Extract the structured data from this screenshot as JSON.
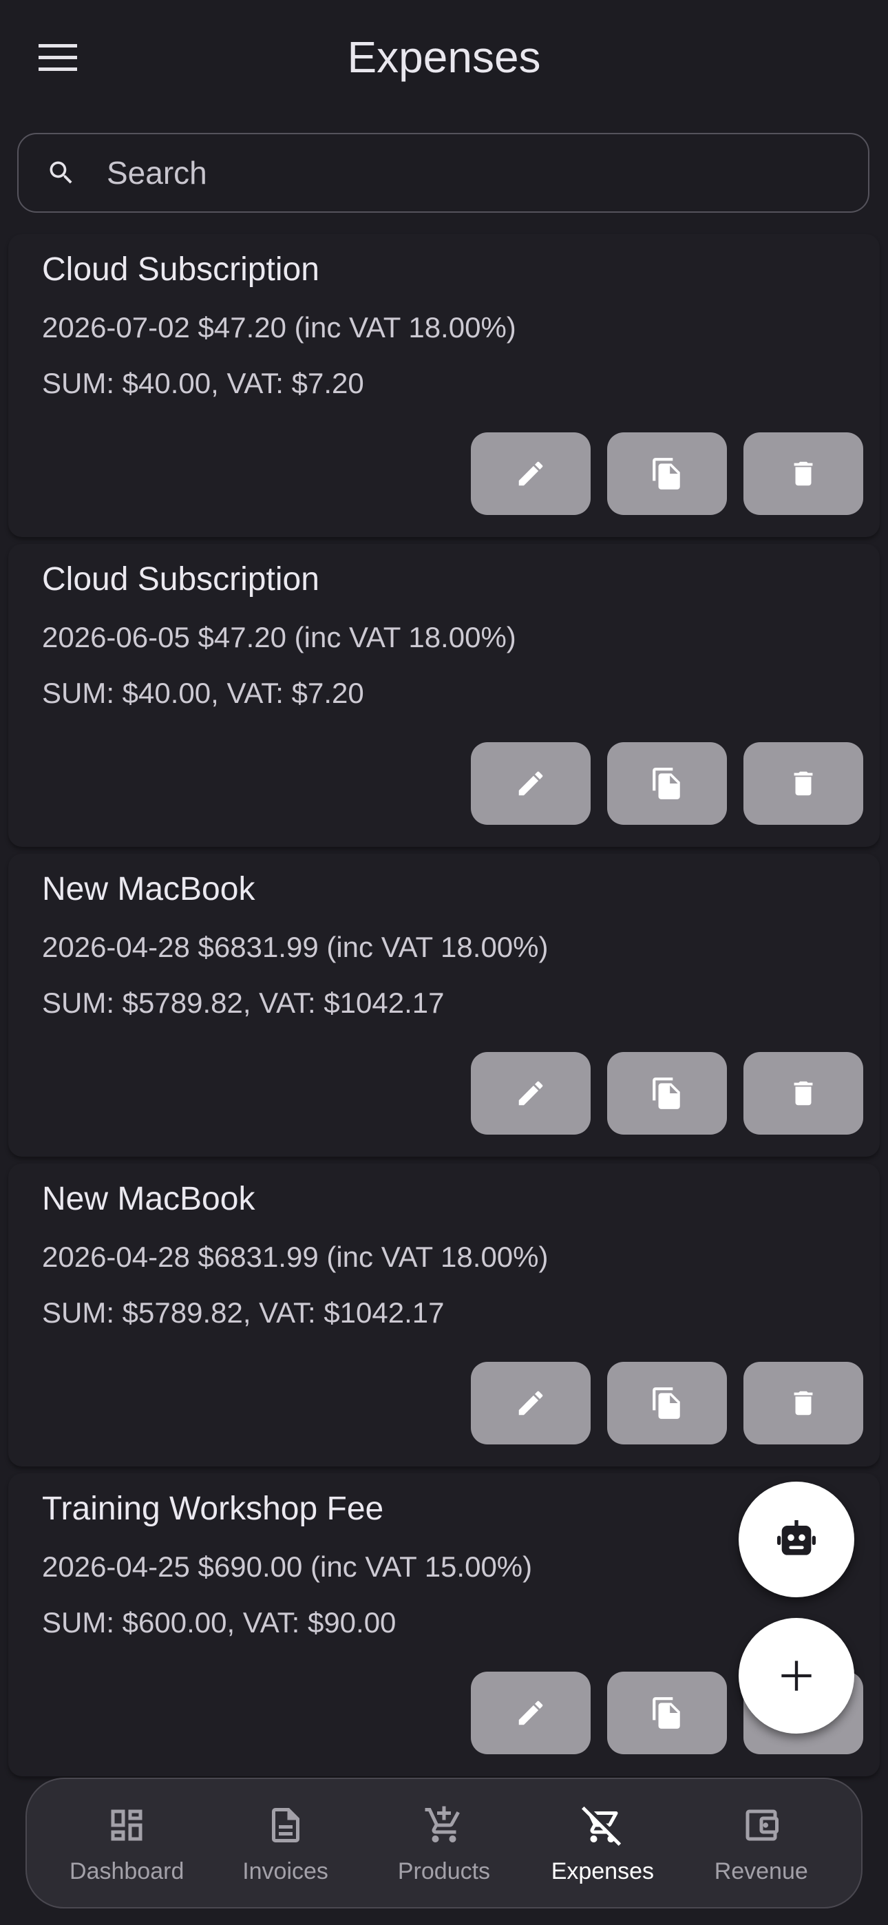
{
  "header": {
    "title": "Expenses",
    "menu_icon": "hamburger-menu-icon"
  },
  "search": {
    "placeholder": "Search",
    "icon": "search-icon"
  },
  "expenses": [
    {
      "title": "Cloud Subscription",
      "line1": "2026-07-02 $47.20 (inc VAT 18.00%)",
      "line2": "SUM: $40.00, VAT: $7.20"
    },
    {
      "title": "Cloud Subscription",
      "line1": "2026-06-05 $47.20 (inc VAT 18.00%)",
      "line2": "SUM: $40.00, VAT: $7.20"
    },
    {
      "title": "New MacBook",
      "line1": "2026-04-28 $6831.99 (inc VAT 18.00%)",
      "line2": "SUM: $5789.82, VAT: $1042.17"
    },
    {
      "title": "New MacBook",
      "line1": "2026-04-28 $6831.99 (inc VAT 18.00%)",
      "line2": "SUM: $5789.82, VAT: $1042.17"
    },
    {
      "title": "Training Workshop Fee",
      "line1": "2026-04-25 $690.00 (inc VAT 15.00%)",
      "line2": "SUM: $600.00, VAT: $90.00"
    }
  ],
  "row_actions": [
    "edit-icon",
    "copy-icon",
    "delete-icon"
  ],
  "fabs": {
    "assistant_icon": "robot-icon",
    "add_icon": "plus-icon"
  },
  "nav": {
    "items": [
      {
        "label": "Dashboard",
        "icon": "dashboard-icon"
      },
      {
        "label": "Invoices",
        "icon": "invoice-icon"
      },
      {
        "label": "Products",
        "icon": "cart-add-icon"
      },
      {
        "label": "Expenses",
        "icon": "cart-off-icon",
        "active": true
      },
      {
        "label": "Revenue",
        "icon": "wallet-icon"
      }
    ]
  },
  "colors": {
    "background": "#1d1c22",
    "action_button": "#9c9aa0",
    "fab": "#ffffff",
    "active_nav": "#ffffff",
    "inactive_nav": "#a3a1a9"
  }
}
